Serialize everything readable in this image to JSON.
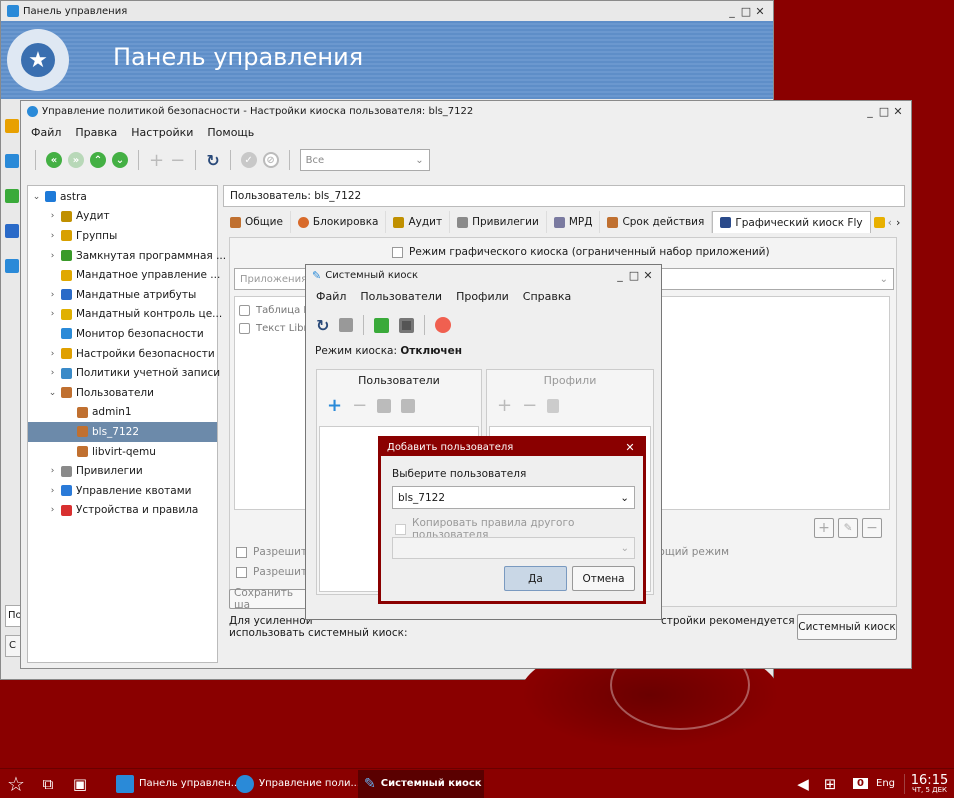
{
  "desktop": {
    "bg": "#8a0000"
  },
  "control_panel": {
    "title": "Панель управления",
    "banner_title": "Панель управления",
    "left_input_placeholder": "По",
    "left_btn": "С"
  },
  "policy": {
    "title": "Управление политикой безопасности - Настройки киоска пользователя: bls_7122",
    "menu": [
      "Файл",
      "Правка",
      "Настройки",
      "Помощь"
    ],
    "filter_value": "Все",
    "tree": [
      {
        "label": "astra",
        "depth": 0,
        "arrow": "⌄",
        "icon": "computer-icon",
        "color": "#1e7ad8"
      },
      {
        "label": "Аудит",
        "depth": 1,
        "arrow": "›",
        "icon": "audit-icon",
        "color": "#c09000"
      },
      {
        "label": "Группы",
        "depth": 1,
        "arrow": "›",
        "icon": "groups-icon",
        "color": "#d8a000"
      },
      {
        "label": "Замкнутая программная ...",
        "depth": 1,
        "arrow": "›",
        "icon": "closed-env-icon",
        "color": "#3a9a2a"
      },
      {
        "label": "Мандатное управление ...",
        "depth": 1,
        "arrow": "",
        "icon": "mandatory-icon",
        "color": "#e0a800"
      },
      {
        "label": "Мандатные атрибуты",
        "depth": 1,
        "arrow": "›",
        "icon": "attributes-icon",
        "color": "#2a6ac8"
      },
      {
        "label": "Мандатный контроль це...",
        "depth": 1,
        "arrow": "›",
        "icon": "integrity-icon",
        "color": "#e0b000"
      },
      {
        "label": "Монитор безопасности",
        "depth": 1,
        "arrow": "",
        "icon": "monitor-icon",
        "color": "#2a8ad8"
      },
      {
        "label": "Настройки безопасности",
        "depth": 1,
        "arrow": "›",
        "icon": "settings-icon",
        "color": "#e0a000"
      },
      {
        "label": "Политики учетной записи",
        "depth": 1,
        "arrow": "›",
        "icon": "account-policy-icon",
        "color": "#3a8ac8"
      },
      {
        "label": "Пользователи",
        "depth": 1,
        "arrow": "⌄",
        "icon": "users-icon",
        "color": "#c07030"
      },
      {
        "label": "admin1",
        "depth": 2,
        "arrow": "",
        "icon": "user-icon",
        "color": "#c07030"
      },
      {
        "label": "bls_7122",
        "depth": 2,
        "arrow": "",
        "icon": "user-icon",
        "color": "#c07030",
        "selected": true
      },
      {
        "label": "libvirt-qemu",
        "depth": 2,
        "arrow": "",
        "icon": "user-icon",
        "color": "#c07030"
      },
      {
        "label": "Привилегии",
        "depth": 1,
        "arrow": "›",
        "icon": "privileges-icon",
        "color": "#8a8a8a"
      },
      {
        "label": "Управление квотами",
        "depth": 1,
        "arrow": "›",
        "icon": "quota-icon",
        "color": "#2a7ad8"
      },
      {
        "label": "Устройства и правила",
        "depth": 1,
        "arrow": "›",
        "icon": "devices-icon",
        "color": "#d83030"
      }
    ],
    "user_label": "Пользователь: bls_7122",
    "tabs": [
      "Общие",
      "Блокировка",
      "Аудит",
      "Привилегии",
      "МРД",
      "Срок действия",
      "Графический киоск Fly"
    ],
    "kiosk_mode_label": "Режим графического киоска (ограниченный набор приложений)",
    "apps_label": "Приложения",
    "apps": [
      "Таблица L",
      "Текст Libre"
    ],
    "allow1": "Разрешить",
    "allow2": "Разрешить",
    "mode_fragment": "ющий режим",
    "save_btn": "Сохранить ша",
    "footer_text_1": "Для усиленной",
    "footer_text_2": "стройки рекомендуется",
    "footer_text_3": "использовать системный киоск:",
    "sys_kiosk_btn": "Системный киоск"
  },
  "kiosk": {
    "title": "Системный киоск",
    "menu": [
      "Файл",
      "Пользователи",
      "Профили",
      "Справка"
    ],
    "mode_label": "Режим киоска:",
    "mode_value": "Отключен",
    "users_header": "Пользователи",
    "profiles_header": "Профили"
  },
  "dialog": {
    "title": "Добавить пользователя",
    "select_label": "Выберите пользователя",
    "selected_user": "bls_7122",
    "copy_rules": "Копировать правила другого пользователя",
    "ok": "Да",
    "cancel": "Отмена"
  },
  "taskbar": {
    "tasks": [
      "Панель управлен...",
      "Управление поли...",
      "Системный киоск"
    ],
    "badge": "0",
    "lang": "Eng",
    "time": "16:15",
    "date": "ЧТ, 5 ДЕК"
  }
}
